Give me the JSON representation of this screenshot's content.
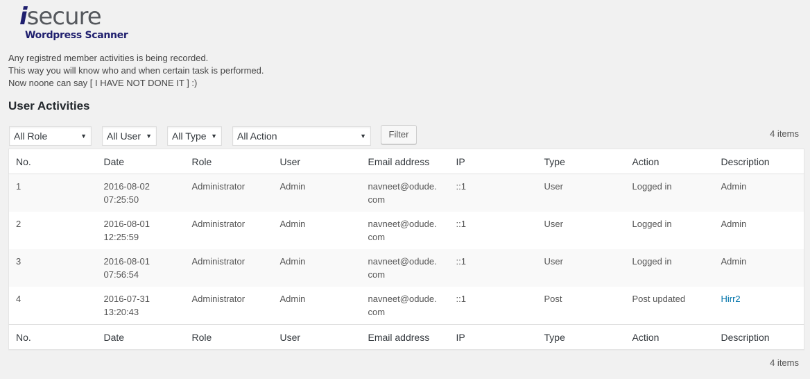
{
  "logo": {
    "brand_i": "i",
    "brand_rest": "secure",
    "subtitle": "Wordpress Scanner"
  },
  "intro": [
    "Any registred member activities is being recorded.",
    "This way you will know who and when certain task is performed.",
    "Now noone can say [ I HAVE NOT DONE IT ] :)"
  ],
  "section_title": "User Activities",
  "filters": {
    "role": "All Role",
    "user": "All User",
    "type": "All Type",
    "action": "All Action",
    "filter_button": "Filter"
  },
  "item_count": "4 items",
  "columns": [
    "No.",
    "Date",
    "Role",
    "User",
    "Email address",
    "IP",
    "Type",
    "Action",
    "Description"
  ],
  "rows": [
    {
      "no": "1",
      "date": "2016-08-02",
      "time": "07:25:50",
      "role": "Administrator",
      "user": "Admin",
      "email1": "navneet@odude.",
      "email2": "com",
      "ip": "::1",
      "type": "User",
      "action": "Logged in",
      "description": "Admin"
    },
    {
      "no": "2",
      "date": "2016-08-01",
      "time": "12:25:59",
      "role": "Administrator",
      "user": "Admin",
      "email1": "navneet@odude.",
      "email2": "com",
      "ip": "::1",
      "type": "User",
      "action": "Logged in",
      "description": "Admin"
    },
    {
      "no": "3",
      "date": "2016-08-01",
      "time": "07:56:54",
      "role": "Administrator",
      "user": "Admin",
      "email1": "navneet@odude.",
      "email2": "com",
      "ip": "::1",
      "type": "User",
      "action": "Logged in",
      "description": "Admin"
    },
    {
      "no": "4",
      "date": "2016-07-31",
      "time": "13:20:43",
      "role": "Administrator",
      "user": "Admin",
      "email1": "navneet@odude.",
      "email2": "com",
      "ip": "::1",
      "type": "Post",
      "action": "Post updated",
      "description": "Hirr2"
    }
  ],
  "colors": {
    "link": "#0073aa",
    "background": "#f1f1f1",
    "brand": "#1f1f6e"
  },
  "icons": {
    "dropdown": "chevron-down-icon"
  }
}
